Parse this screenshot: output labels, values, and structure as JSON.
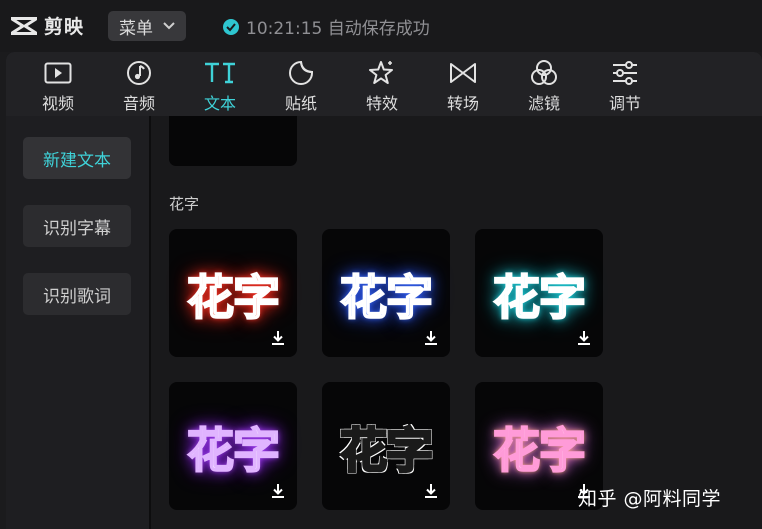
{
  "app": {
    "name": "剪映",
    "menu_label": "菜单",
    "save_status": "10:21:15 自动保存成功"
  },
  "colors": {
    "accent": "#3fd2d8",
    "background": "#1b1b1d",
    "card": "#060607"
  },
  "tabs": [
    {
      "label": "视频",
      "icon": "video-icon"
    },
    {
      "label": "音频",
      "icon": "music-note-icon"
    },
    {
      "label": "文本",
      "icon": "text-tt-icon",
      "active": true
    },
    {
      "label": "贴纸",
      "icon": "sticker-icon"
    },
    {
      "label": "特效",
      "icon": "sparkle-star-icon"
    },
    {
      "label": "转场",
      "icon": "bowtie-transition-icon"
    },
    {
      "label": "滤镜",
      "icon": "filter-circles-icon"
    },
    {
      "label": "调节",
      "icon": "sliders-icon"
    }
  ],
  "sidebar": {
    "items": [
      {
        "label": "新建文本",
        "active": true
      },
      {
        "label": "识别字幕"
      },
      {
        "label": "识别歌词"
      }
    ]
  },
  "content": {
    "section_title": "花字",
    "cards": [
      {
        "text": "花字",
        "style": "red-glow",
        "icon": "download-icon"
      },
      {
        "text": "花字",
        "style": "blue-glow",
        "icon": "download-icon"
      },
      {
        "text": "花字",
        "style": "cyan-glow",
        "icon": "download-icon"
      },
      {
        "text": "花字",
        "style": "purple-glow",
        "icon": "download-icon"
      },
      {
        "text": "花字",
        "style": "white-outline",
        "icon": "download-icon"
      },
      {
        "text": "花字",
        "style": "pastel-gradient",
        "icon": "download-icon"
      }
    ]
  },
  "watermark": "知乎 @阿料同学"
}
